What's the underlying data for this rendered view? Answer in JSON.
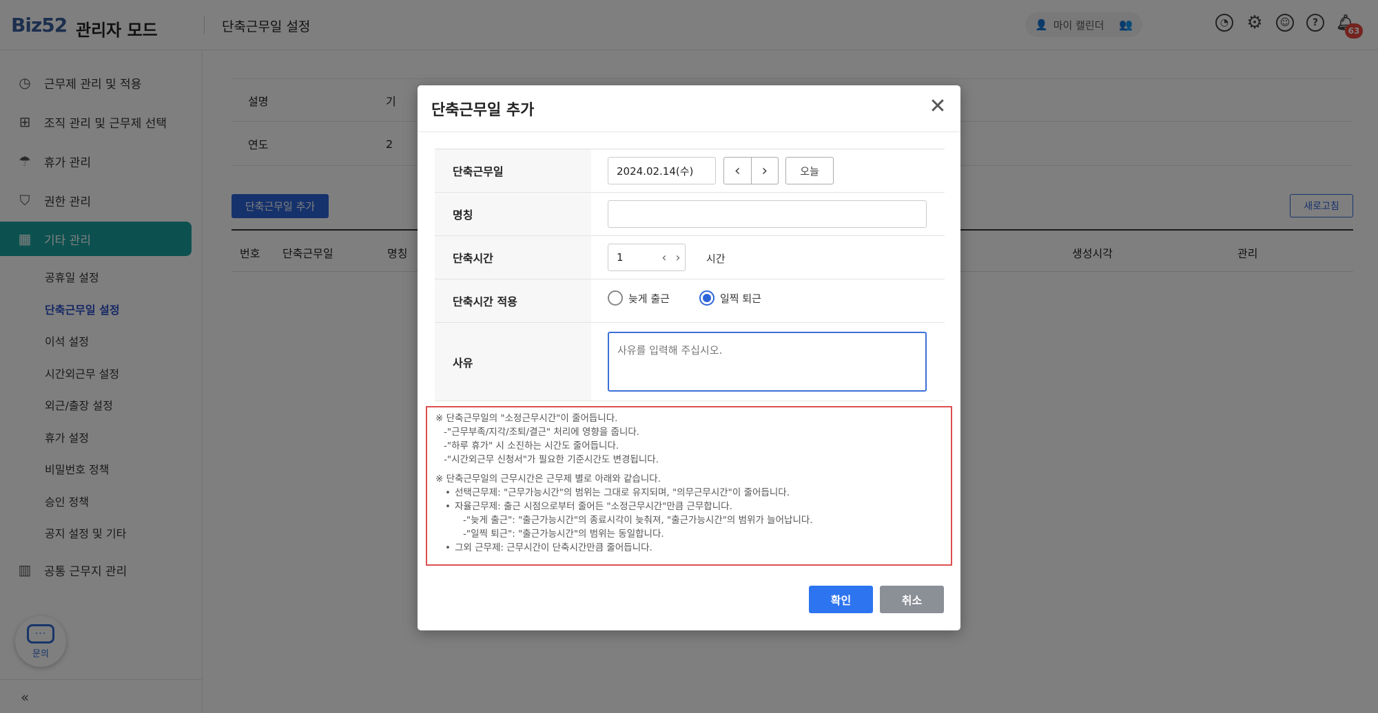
{
  "header": {
    "logo_text": "Biz52",
    "mode_title": "관리자 모드",
    "page_title": "단축근무일 설정",
    "calendar_label": "마이 캘린더",
    "notification_count": "63"
  },
  "sidebar": {
    "items": [
      {
        "label": "근무제 관리 및 적용"
      },
      {
        "label": "조직 관리 및 근무제 선택"
      },
      {
        "label": "휴가 관리"
      },
      {
        "label": "권한 관리"
      },
      {
        "label": "기타 관리"
      },
      {
        "label": "공통 근무지 관리"
      }
    ],
    "sub_items": [
      "공휴일 설정",
      "단축근무일 설정",
      "이석 설정",
      "시간외근무 설정",
      "외근/출장 설정",
      "휴가 설정",
      "비밀번호 정책",
      "승인 정책",
      "공지 설정 및 기타"
    ],
    "chat_label": "문의"
  },
  "content": {
    "rows": [
      {
        "label": "설명",
        "value": "기"
      },
      {
        "label": "연도",
        "value": "2"
      }
    ],
    "add_button": "단축근무일 추가",
    "refresh_button": "새로고침",
    "columns": [
      "번호",
      "단축근무일",
      "명칭",
      "생성시각",
      "관리"
    ]
  },
  "modal": {
    "title": "단축근무일 추가",
    "fields": {
      "date_label": "단축근무일",
      "date_value": "2024.02.14(수)",
      "today_button": "오늘",
      "name_label": "명칭",
      "name_value": "",
      "time_label": "단축시간",
      "time_value": "1",
      "time_unit": "시간",
      "apply_label": "단축시간 적용",
      "apply_options": [
        "늦게 출근",
        "일찍 퇴근"
      ],
      "apply_selected": "일찍 퇴근",
      "reason_label": "사유",
      "reason_placeholder": "사유를 입력해 주십시오."
    },
    "notice": {
      "line1": "※ 단축근무일의 \"소정근무시간\"이 줄어듭니다.",
      "line2": "-\"근무부족/지각/조퇴/결근\" 처리에 영향을 줍니다.",
      "line3": "-\"하루 휴가\" 시 소진하는 시간도 줄어듭니다.",
      "line4": "-\"시간외근무 신청서\"가 필요한 기준시간도 변경됩니다.",
      "line5": "※ 단축근무일의 근무시간은 근무제 별로 아래와 같습니다.",
      "line6": "선택근무제: \"근무가능시간\"의 범위는 그대로 유지되며, \"의무근무시간\"이 줄어듭니다.",
      "line7": "자율근무제: 출근 시점으로부터 줄어든 \"소정근무시간\"만큼 근무합니다.",
      "line8": "-\"늦게 출근\": \"출근가능시간\"의 종료시각이 늦춰져, \"출근가능시간\"의 범위가 늘어납니다.",
      "line9": "-\"일찍 퇴근\": \"출근가능시간\"의 범위는 동일합니다.",
      "line10": "그외 근무제: 근무시간이 단축시간만큼 줄어듭니다."
    },
    "confirm_button": "확인",
    "cancel_button": "취소"
  }
}
